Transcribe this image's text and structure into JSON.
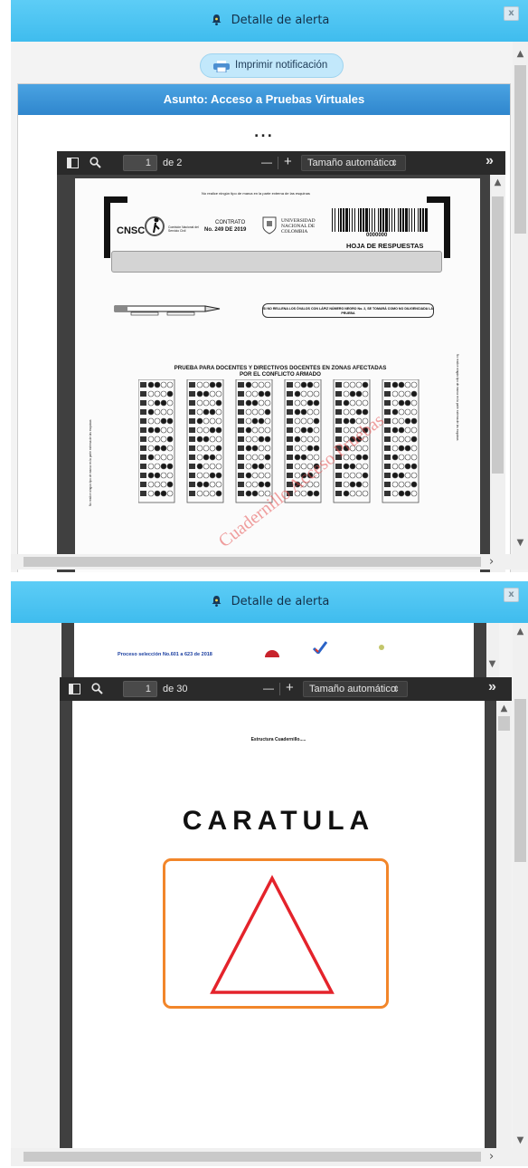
{
  "window_title": "Detalle de alerta",
  "close_glyph": "x",
  "print_button": {
    "label": "Imprimir notificación",
    "icon": "printer-icon"
  },
  "panel": {
    "title": "Asunto: Acceso a Pruebas Virtuales",
    "ellipsis": "..."
  },
  "viewer1": {
    "page_number": "1",
    "page_total": "de 2",
    "zoom_minus": "—",
    "zoom_plus": "+",
    "zoom_label": "Tamaño automático",
    "tools_more": "»",
    "document": {
      "top_notice": "No realice ningún tipo de marca en la parte externa de las esquinas",
      "cnsc": "CNSC",
      "cnsc_sub": "Comisión Nacional del Servicio Civil",
      "contract_label": "CONTRATO",
      "contract_no": "No. 249 DE 2019",
      "university": "UNIVERSIDAD NACIONAL DE COLOMBIA",
      "barcode_number": "0000000",
      "sheet_label": "HOJA DE RESPUESTAS",
      "notice_box": "SI NO RELLENA LOS ÓVALOS CON LÁPIZ NÚMERO NEGRO No. 2, SE TOMARÁ COMO NO DILIGENCIADA LA PRUEBA",
      "heading_line1": "PRUEBA PARA DOCENTES Y DIRECTIVOS DOCENTES EN ZONAS AFECTADAS",
      "heading_line2": "POR EL CONFLICTO ARMADO",
      "side_text": "No realice ningún tipo de marca en la parte externa de las esquinas",
      "watermark": "Cuadernillo Acceso Pruebas"
    }
  },
  "behind_doc": {
    "text": "Proceso selección No.601 a 623 de 2018"
  },
  "viewer2": {
    "page_number": "1",
    "page_total": "de 30",
    "zoom_minus": "—",
    "zoom_plus": "+",
    "zoom_label": "Tamaño automático",
    "tools_more": "»",
    "document": {
      "header_small": "Estructura Cuadernillo.....",
      "big_title": "CARATULA"
    }
  },
  "colors": {
    "titlebar": "#46c0f1",
    "panel_header": "#3a93d8",
    "viewer_toolbar": "#2a2a2a",
    "orange_box": "#f2862a",
    "triangle": "#e4232b"
  }
}
